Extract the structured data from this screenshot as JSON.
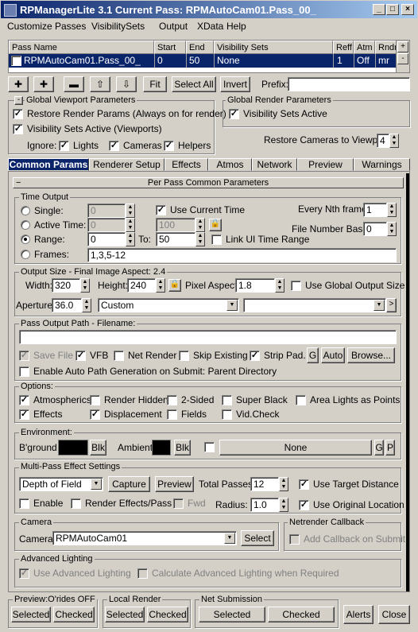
{
  "window": {
    "title": "RPManagerLite 3.1   Current Pass: RPMAutoCam01.Pass_00_"
  },
  "menu": [
    "Customize",
    "Passes",
    "VisibilitySets",
    "Output",
    "XData",
    "Help"
  ],
  "grid": {
    "columns": [
      "Pass Name",
      "Start",
      "End",
      "Visibility Sets",
      "Reff",
      "Atm",
      "Rndr"
    ],
    "rows": [
      {
        "checked": true,
        "name": "RPMAutoCam01.Pass_00_",
        "start": "0",
        "end": "50",
        "visibility": "None",
        "reff": "1",
        "atm": "Off",
        "rndr": "mr"
      }
    ]
  },
  "toolbar": {
    "fit": "Fit",
    "select_all": "Select All",
    "invert": "Invert",
    "prefix_label": "Prefix:",
    "prefix_value": ""
  },
  "global_viewport": {
    "title": "Global Viewport Parameters",
    "restore_render_params": "Restore Render Params (Always on for render)",
    "visibility_sets_active": "Visibility Sets Active (Viewports)",
    "ignore_label": "Ignore:",
    "lights": "Lights",
    "cameras": "Cameras",
    "helpers": "Helpers"
  },
  "global_render": {
    "title": "Global Render Parameters",
    "visibility_sets_active": "Visibility Sets Active",
    "restore_cameras_label": "Restore Cameras to Viewport:",
    "restore_cameras_value": "4"
  },
  "tabs": [
    "Common Params",
    "Renderer Setup",
    "Effects",
    "Atmos",
    "Network",
    "Preview",
    "Warnings"
  ],
  "rollout_title": "Per Pass Common Parameters",
  "time_output": {
    "title": "Time Output",
    "single_label": "Single:",
    "single_value": "0",
    "use_current_time": "Use Current Time",
    "every_nth_label": "Every Nth frame:",
    "every_nth_value": "1",
    "active_time_label": "Active Time:",
    "active_time_value": "0",
    "active_time_to": "100",
    "file_number_base_label": "File Number Base:",
    "file_number_base_value": "0",
    "range_label": "Range:",
    "range_from": "0",
    "range_to_label": "To:",
    "range_to": "50",
    "link_ui_time": "Link UI Time Range",
    "frames_label": "Frames:",
    "frames_value": "1,3,5-12"
  },
  "output_size": {
    "title": "Output Size - Final Image Aspect: 2.4",
    "width_label": "Width:",
    "width_value": "320",
    "height_label": "Height:",
    "height_value": "240",
    "pixel_aspect_label": "Pixel Aspect:",
    "pixel_aspect_value": "1.8",
    "use_global_output_size": "Use Global Output Size",
    "aperture_label": "Aperture:",
    "aperture_value": "36.0",
    "preset": "Custom",
    "preset2": ""
  },
  "pass_output": {
    "title": "Pass Output Path - Filename:",
    "path_value": "",
    "save_file": "Save File",
    "vfb": "VFB",
    "net_render": "Net Render",
    "skip_existing": "Skip Existing",
    "strip_pad": "Strip Pad.",
    "g_button": "G",
    "auto_button": "Auto",
    "browse_button": "Browse...",
    "enable_auto_path": "Enable Auto Path Generation on Submit: Parent Directory"
  },
  "options": {
    "title": "Options:",
    "atmospherics": "Atmospherics",
    "render_hidden": "Render Hidden",
    "two_sided": "2-Sided",
    "super_black": "Super Black",
    "area_lights_as_points": "Area Lights as Points",
    "effects": "Effects",
    "displacement": "Displacement",
    "fields": "Fields",
    "vid_check": "Vid.Check"
  },
  "environment": {
    "title": "Environment:",
    "bground_label": "B'ground",
    "blk1": "Blk",
    "ambient_label": "Ambient",
    "blk2": "Blk",
    "map_button": "None",
    "g_button": "G",
    "p_button": "P"
  },
  "multipass": {
    "title": "Multi-Pass Effect Settings",
    "effect_type": "Depth of Field",
    "capture": "Capture",
    "preview": "Preview",
    "total_passes_label": "Total Passes:",
    "total_passes_value": "12",
    "use_target_distance": "Use Target Distance",
    "enable": "Enable",
    "render_effects_per_pass": "Render Effects/Pass",
    "fwd": "Fwd",
    "radius_label": "Radius:",
    "radius_value": "1.0",
    "use_original_location": "Use Original Location"
  },
  "camera": {
    "title": "Camera",
    "label": "Camera:",
    "value": "RPMAutoCam01",
    "select_button": "Select"
  },
  "netrender_callback": {
    "title": "Netrender Callback",
    "add_callback": "Add Callback on Submit"
  },
  "advanced_lighting": {
    "title": "Advanced Lighting",
    "use_advanced": "Use Advanced Lighting",
    "calculate_when_required": "Calculate Advanced Lighting when Required"
  },
  "bottom": {
    "preview_title": "Preview:O'rides OFF",
    "preview_selected": "Selected",
    "preview_checked": "Checked",
    "local_title": "Local Render",
    "local_selected": "Selected",
    "local_checked": "Checked",
    "net_title": "Net Submission",
    "net_selected": "Selected",
    "net_checked": "Checked",
    "alerts": "Alerts",
    "close": "Close"
  }
}
